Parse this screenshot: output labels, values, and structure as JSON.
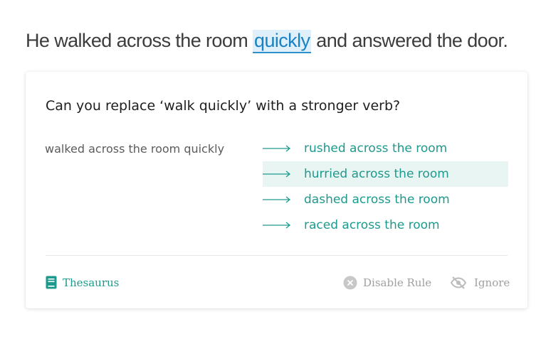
{
  "sentence": {
    "before": "He walked across the room ",
    "highlight": "quickly",
    "after": " and answered the door."
  },
  "card": {
    "question": "Can you replace ‘walk quickly’ with a stronger verb?",
    "original": "walked across the room quickly",
    "suggestions": [
      {
        "label": "rushed across the room",
        "active": false
      },
      {
        "label": "hurried across the room",
        "active": true
      },
      {
        "label": "dashed across the room",
        "active": false
      },
      {
        "label": "raced across the room",
        "active": false
      }
    ],
    "footer": {
      "thesaurus_label": "Thesaurus",
      "disable_label": "Disable Rule",
      "ignore_label": "Ignore"
    },
    "icons": {
      "suggestion_arrow": "arrow-right-icon",
      "thesaurus": "book-icon",
      "disable": "close-circle-icon",
      "ignore": "eye-off-icon"
    }
  },
  "colors": {
    "accent": "#1d9a8d",
    "highlight_text": "#1a82c4",
    "highlight_bg": "#dff0fa",
    "active_row_bg": "#e9f5f3",
    "muted": "#a0a0a0"
  }
}
